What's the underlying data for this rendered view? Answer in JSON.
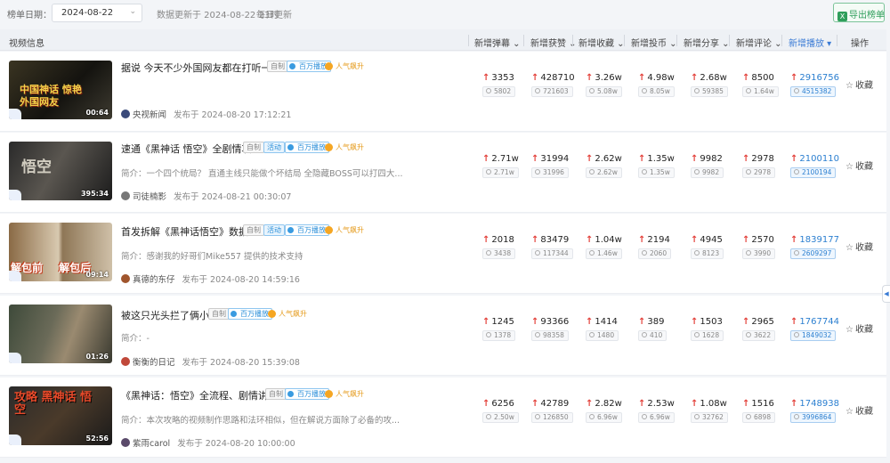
{
  "topbar": {
    "date_label": "榜单日期：",
    "date_value": "2024-08-22",
    "update_text": "数据更新于 2024-08-22 23时",
    "daily_text": "每日更新",
    "export_label": "导出榜单"
  },
  "columns": {
    "video": "视频信息",
    "danmu": "新增弹幕",
    "likes": "新增获赞",
    "favs": "新增收藏",
    "coins": "新增投币",
    "shares": "新增分享",
    "comments": "新增评论",
    "plays": "新增播放",
    "action": "操作"
  },
  "tags": {
    "self": "自制",
    "event": "活动",
    "million": "百万播放",
    "hot": "人气飙升"
  },
  "rows": [
    {
      "title": "据说 今天不少外国网友都在打听一...",
      "desc": "",
      "author": "央视新闻",
      "published": "发布于 2024-08-20 17:12:21",
      "duration": "00:64",
      "thumb_caption": "中国神话 惊艳外国网友",
      "has_event": false,
      "stats": {
        "danmu": {
          "main": "3353",
          "sub": "5802"
        },
        "likes": {
          "main": "428710",
          "sub": "721603"
        },
        "favs": {
          "main": "3.26w",
          "sub": "5.08w"
        },
        "coins": {
          "main": "4.98w",
          "sub": "8.05w"
        },
        "shares": {
          "main": "2.68w",
          "sub": "59385"
        },
        "comments": {
          "main": "8500",
          "sub": "1.64w"
        },
        "plays": {
          "main": "2916756",
          "sub": "4515382"
        }
      }
    },
    {
      "title": "速通《黑神话 悟空》全剧情攻...",
      "desc": "简介：一个四个统局？ 直通主线只能做个坏结局 全隐藏BOSS可以打四大...",
      "author": "司徒楠影",
      "published": "发布于 2024-08-21 00:30:07",
      "duration": "395:34",
      "thumb_caption": "悟空",
      "has_event": true,
      "stats": {
        "danmu": {
          "main": "2.71w",
          "sub": "2.71w"
        },
        "likes": {
          "main": "31994",
          "sub": "31996"
        },
        "favs": {
          "main": "2.62w",
          "sub": "2.62w"
        },
        "coins": {
          "main": "1.35w",
          "sub": "1.35w"
        },
        "shares": {
          "main": "9982",
          "sub": "9982"
        },
        "comments": {
          "main": "2978",
          "sub": "2978"
        },
        "plays": {
          "main": "2100110",
          "sub": "2100194"
        }
      }
    },
    {
      "title": "首发拆解《黑神话悟空》数据...",
      "desc": "简介：感谢我的好哥们Mike557 提供的技术支持",
      "author": "真德的东仔",
      "published": "发布于 2024-08-20 14:59:16",
      "duration": "09:14",
      "thumb_caption": "解包前 解包后",
      "has_event": true,
      "stats": {
        "danmu": {
          "main": "2018",
          "sub": "3438"
        },
        "likes": {
          "main": "83479",
          "sub": "117344"
        },
        "favs": {
          "main": "1.04w",
          "sub": "1.46w"
        },
        "coins": {
          "main": "2194",
          "sub": "2060"
        },
        "shares": {
          "main": "4945",
          "sub": "8123"
        },
        "comments": {
          "main": "2570",
          "sub": "3990"
        },
        "plays": {
          "main": "1839177",
          "sub": "2609297"
        }
      }
    },
    {
      "title": "被这只光头拦了俩小时",
      "desc": "简介：-",
      "author": "衡衡的日记",
      "published": "发布于 2024-08-20 15:39:08",
      "duration": "01:26",
      "thumb_caption": "",
      "has_event": false,
      "stats": {
        "danmu": {
          "main": "1245",
          "sub": "1378"
        },
        "likes": {
          "main": "93366",
          "sub": "98358"
        },
        "favs": {
          "main": "1414",
          "sub": "1480"
        },
        "coins": {
          "main": "389",
          "sub": "410"
        },
        "shares": {
          "main": "1503",
          "sub": "1628"
        },
        "comments": {
          "main": "2965",
          "sub": "3622"
        },
        "plays": {
          "main": "1767744",
          "sub": "1849032"
        }
      }
    },
    {
      "title": "《黑神话：悟空》全流程、剧情讲...",
      "desc": "简介：本次攻略的视频制作思路和法环相似，但在解说方面除了必备的攻...",
      "author": "紫雨carol",
      "published": "发布于 2024-08-20 10:00:00",
      "duration": "52:56",
      "thumb_caption": "攻略 黑神话 悟空",
      "has_event": false,
      "stats": {
        "danmu": {
          "main": "6256",
          "sub": "2.50w"
        },
        "likes": {
          "main": "42789",
          "sub": "126850"
        },
        "favs": {
          "main": "2.82w",
          "sub": "6.96w"
        },
        "coins": {
          "main": "2.53w",
          "sub": "6.96w"
        },
        "shares": {
          "main": "1.08w",
          "sub": "32762"
        },
        "comments": {
          "main": "1516",
          "sub": "6898"
        },
        "plays": {
          "main": "1748938",
          "sub": "3996864"
        }
      }
    }
  ],
  "favorite_label": "收藏",
  "colors": {
    "accent_blue": "#2b7fd0",
    "up_red": "#e3403a",
    "export_green": "#2f9e5b",
    "hot_orange": "#f5a623"
  }
}
